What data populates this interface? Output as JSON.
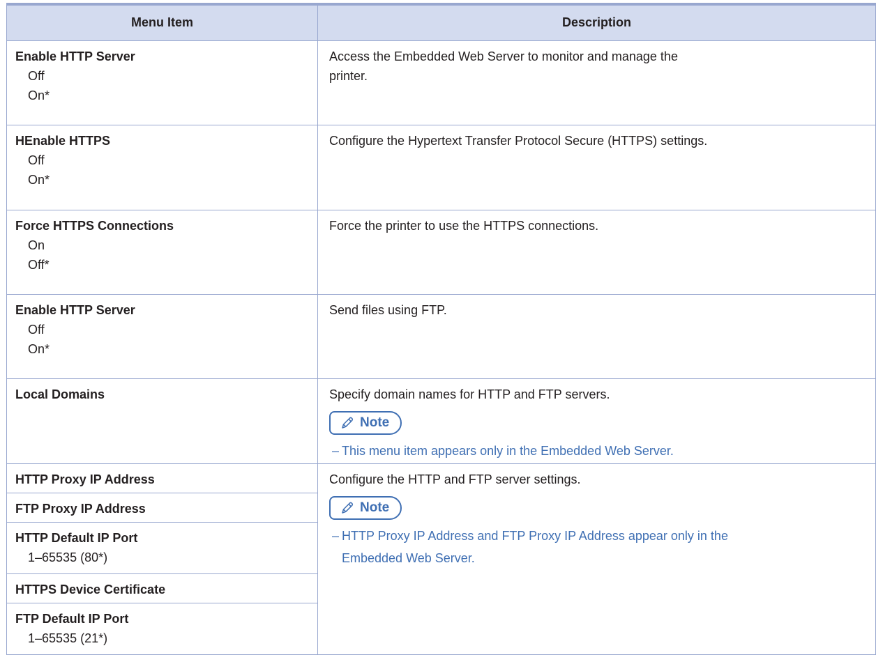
{
  "header": {
    "col1": "Menu Item",
    "col2": "Description"
  },
  "rows": [
    {
      "title": "Enable HTTP Server",
      "options": [
        "Off",
        "On*"
      ],
      "description": "Access the Embedded Web Server to monitor and manage the",
      "description2": "printer."
    },
    {
      "title": "HEnable HTTPS",
      "options": [
        "Off",
        "On*"
      ],
      "description": "Configure the Hypertext Transfer Protocol Secure (HTTPS) settings."
    },
    {
      "title": "Force HTTPS Connections",
      "options": [
        "On",
        "Off*"
      ],
      "description": "Force the printer to use the HTTPS connections."
    },
    {
      "title": "Enable HTTP Server",
      "options": [
        "Off",
        "On*"
      ],
      "description": "Send files using FTP."
    },
    {
      "title": "Local Domains",
      "description": "Specify domain names for HTTP and FTP servers.",
      "note_label": "Note",
      "note": "This menu item appears only in the Embedded Web Server."
    }
  ],
  "proxy_group": {
    "items": [
      {
        "title": "HTTP Proxy IP Address"
      },
      {
        "title": "FTP Proxy IP Address"
      },
      {
        "title": "HTTP Default IP Port",
        "option": "1–65535 (80*)"
      },
      {
        "title": "HTTPS Device Certificate"
      },
      {
        "title": "FTP Default IP Port",
        "option": "1–65535 (21*)"
      }
    ],
    "description": "Configure the HTTP and FTP server settings.",
    "note_label": "Note",
    "note_line1": "HTTP Proxy IP Address and FTP Proxy IP Address appear only in the",
    "note_line2": "Embedded Web Server."
  },
  "colors": {
    "header_bg": "#d3dbef",
    "border": "#98a7cf",
    "note_blue": "#3f6fb3"
  },
  "icons": {
    "note": "pencil-icon"
  }
}
